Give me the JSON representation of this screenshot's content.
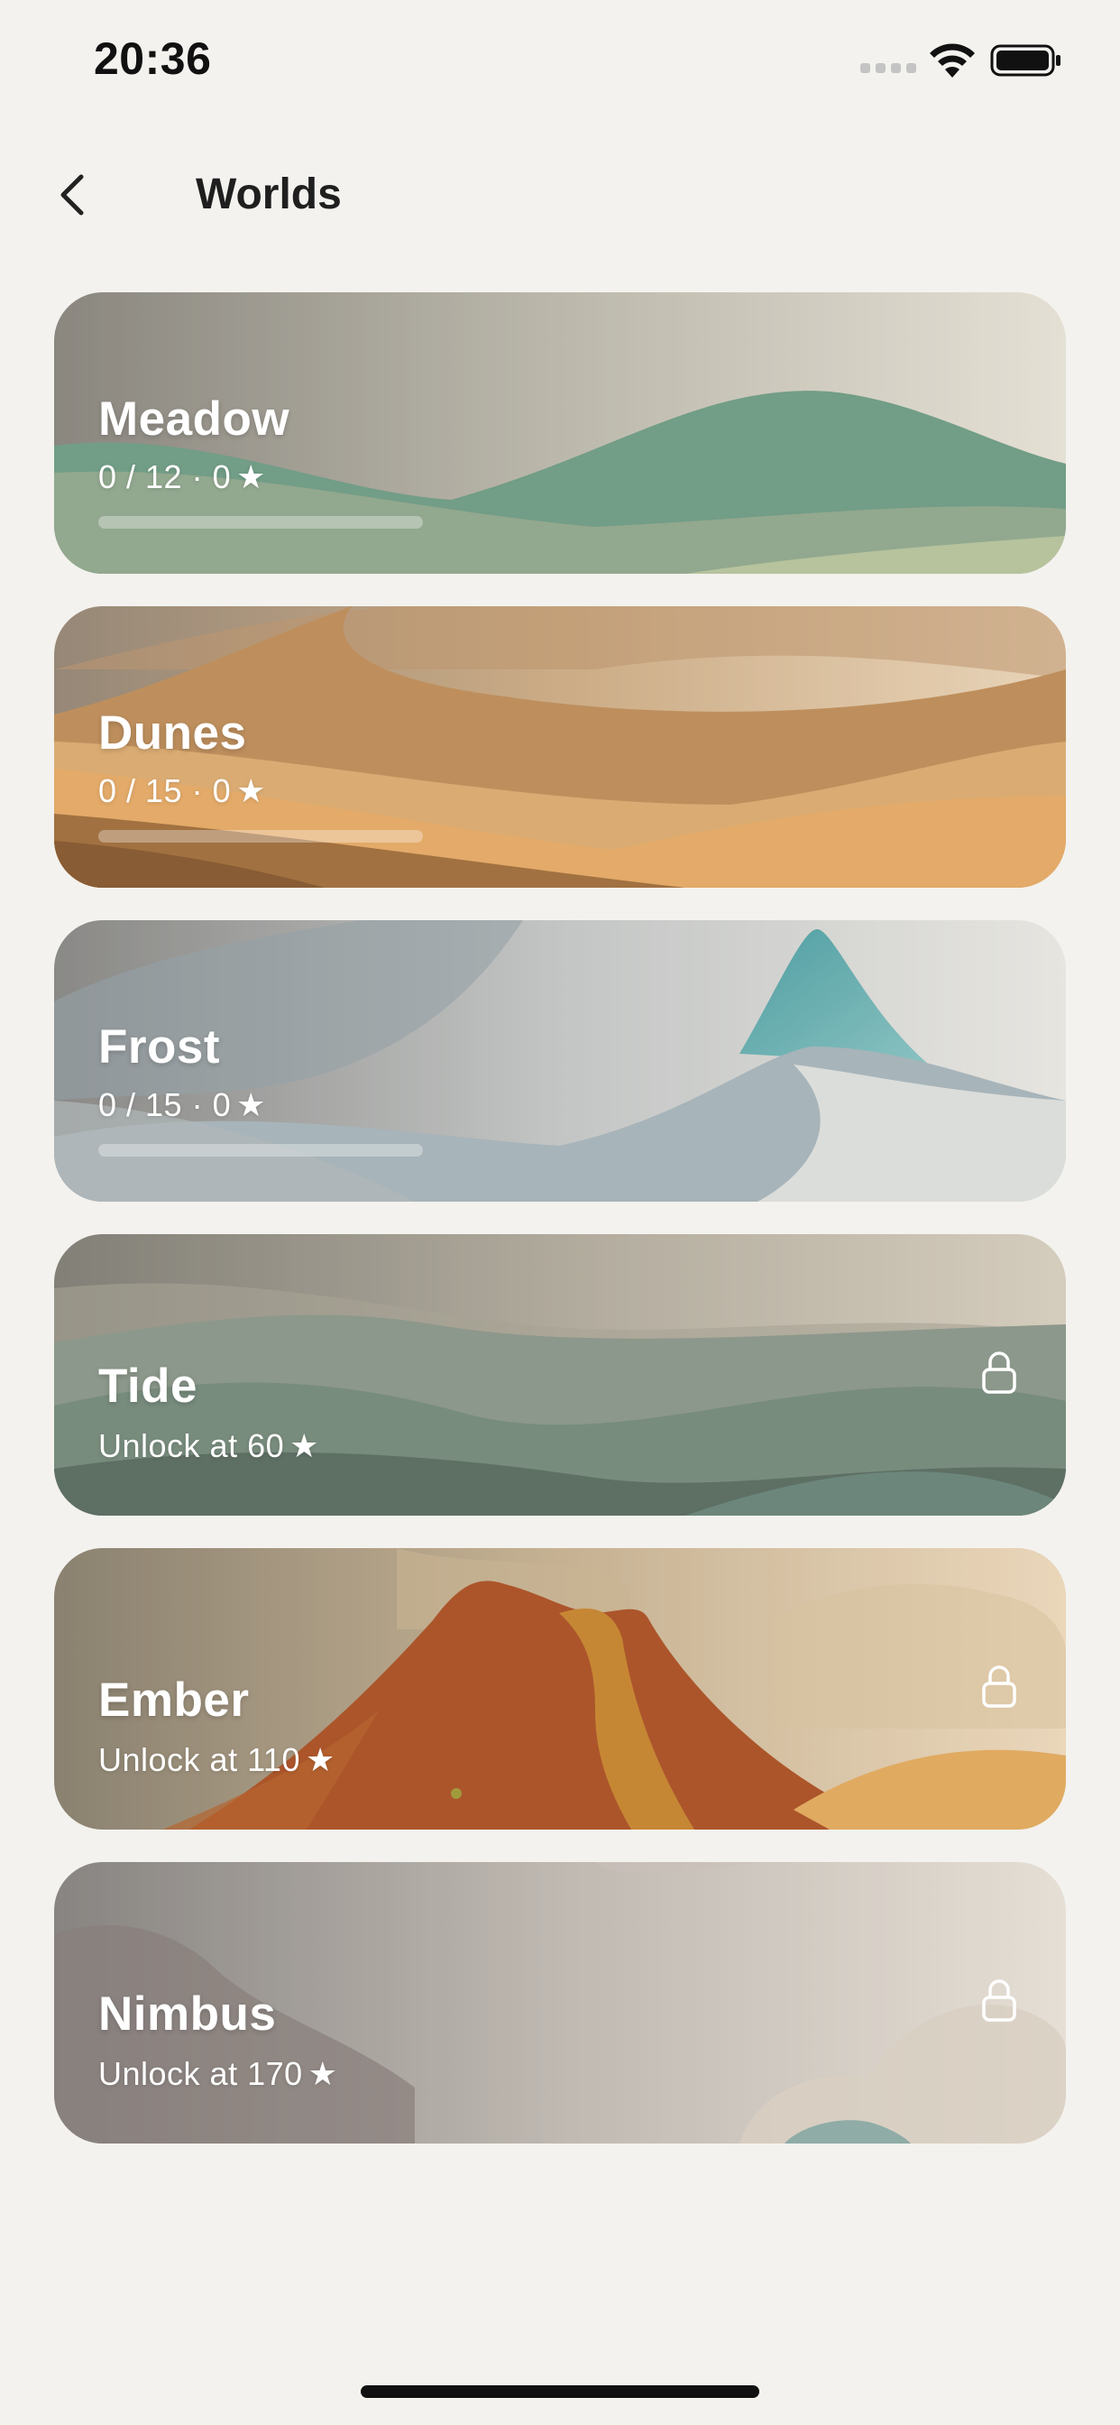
{
  "status_bar": {
    "time": "20:36"
  },
  "header": {
    "title": "Worlds"
  },
  "worlds": [
    {
      "name": "Meadow",
      "meta": "0 / 12 · 0",
      "star": "★",
      "progress": 0,
      "locked": false
    },
    {
      "name": "Dunes",
      "meta": "0 / 15 · 0",
      "star": "★",
      "progress": 0,
      "locked": false
    },
    {
      "name": "Frost",
      "meta": "0 / 15 · 0",
      "star": "★",
      "progress": 0,
      "locked": false
    },
    {
      "name": "Tide",
      "meta": "Unlock at 60",
      "star": "★",
      "locked": true
    },
    {
      "name": "Ember",
      "meta": "Unlock at 110",
      "star": "★",
      "locked": true
    },
    {
      "name": "Nimbus",
      "meta": "Unlock at 170",
      "star": "★",
      "locked": true
    }
  ]
}
